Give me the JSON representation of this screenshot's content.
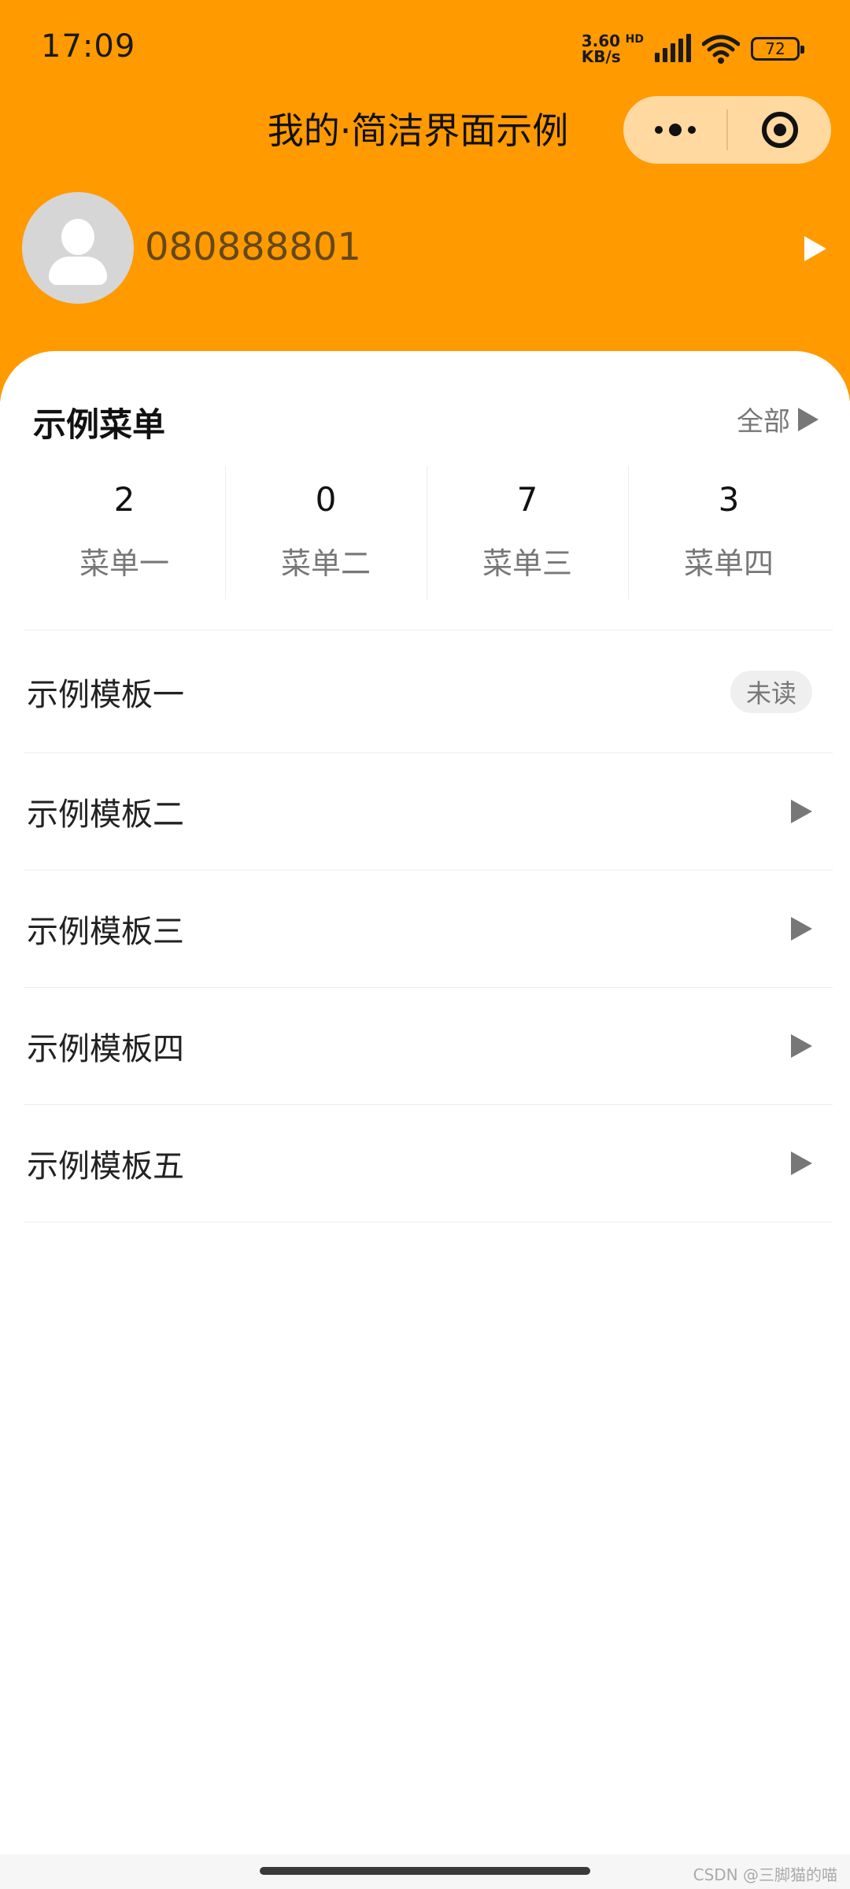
{
  "status_bar": {
    "time": "17:09",
    "net_speed_value": "3.60",
    "net_speed_unit": "KB/s",
    "network_type": "HD",
    "battery": "72",
    "icons": [
      "signal-icon",
      "wifi-icon",
      "battery-icon"
    ]
  },
  "nav": {
    "title": "我的·简洁界面示例",
    "more_icon": "more-dots-icon",
    "close_icon": "target-icon"
  },
  "profile": {
    "phone": "080888801",
    "avatar_icon": "default-avatar-icon",
    "arrow_icon": "triangle-right-icon"
  },
  "menu": {
    "title": "示例菜单",
    "all_label": "全部",
    "stats": [
      {
        "count": "2",
        "label": "菜单一"
      },
      {
        "count": "0",
        "label": "菜单二"
      },
      {
        "count": "7",
        "label": "菜单三"
      },
      {
        "count": "3",
        "label": "菜单四"
      }
    ]
  },
  "list": {
    "items": [
      {
        "label": "示例模板一",
        "badge": "未读"
      },
      {
        "label": "示例模板二"
      },
      {
        "label": "示例模板三"
      },
      {
        "label": "示例模板四"
      },
      {
        "label": "示例模板五"
      }
    ]
  },
  "footer": {
    "watermark": "CSDN @三脚猫的喵"
  },
  "colors": {
    "header_bg": "#ff9a00",
    "capsule_bg": "#ffd9a0",
    "text_secondary": "#777777",
    "divider": "#ececec"
  }
}
